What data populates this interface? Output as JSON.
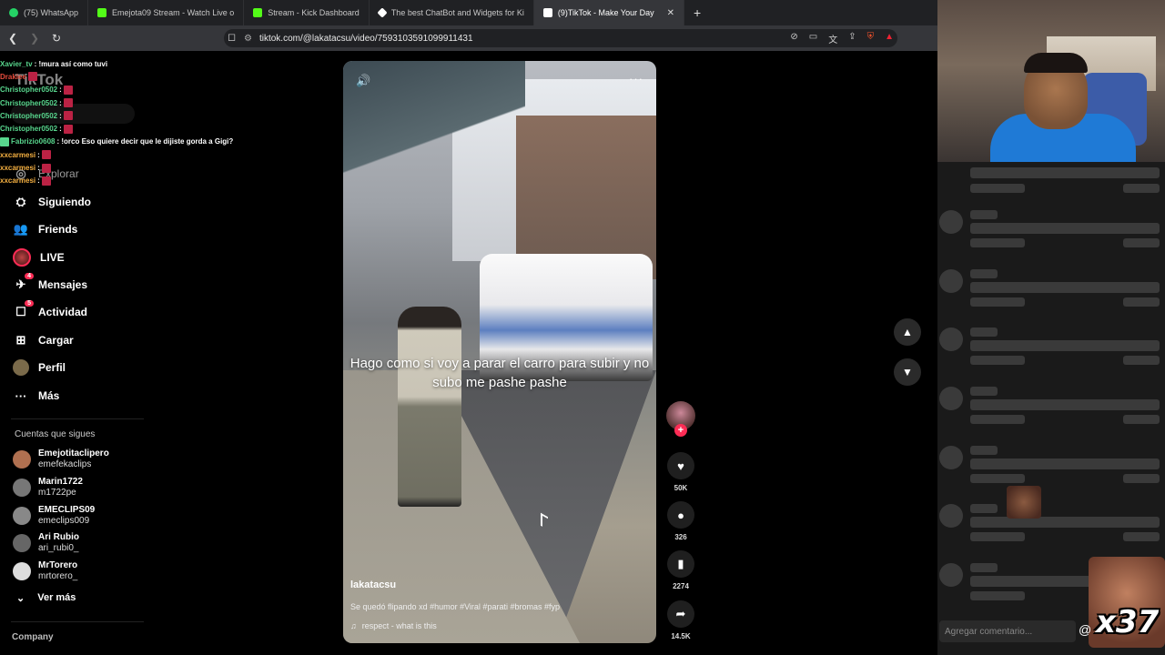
{
  "browser": {
    "tabs": [
      {
        "label": "(75) WhatsApp",
        "favColor": "#25d366"
      },
      {
        "label": "Emejota09 Stream - Watch Live o",
        "favColor": "#53fc18"
      },
      {
        "label": "Stream - Kick Dashboard",
        "favColor": "#53fc18"
      },
      {
        "label": "The best ChatBot and Widgets for Ki",
        "favColor": "#ffffff"
      },
      {
        "label": "(9)TikTok - Make Your Day",
        "favColor": "#ffffff"
      }
    ],
    "new_tab": "+",
    "url": "tiktok.com/@lakatacsu/video/7593103591099911431"
  },
  "tiktok": {
    "logo": "TikTok",
    "nav": [
      {
        "label": "Explorar",
        "icon": "compass-icon"
      },
      {
        "label": "Siguiendo",
        "icon": "following-icon"
      },
      {
        "label": "Friends",
        "icon": "friends-icon"
      },
      {
        "label": "LIVE",
        "icon": "live-icon"
      },
      {
        "label": "Mensajes",
        "icon": "messages-icon",
        "badge": "4"
      },
      {
        "label": "Actividad",
        "icon": "activity-icon",
        "badge": "5"
      },
      {
        "label": "Cargar",
        "icon": "upload-icon"
      },
      {
        "label": "Perfil",
        "icon": "profile-icon"
      },
      {
        "label": "Más",
        "icon": "more-icon"
      }
    ],
    "following_header": "Cuentas que sigues",
    "following": [
      {
        "name": "Emejotitaclipero",
        "handle": "emefekaclips",
        "color": "#b07050"
      },
      {
        "name": "Marin1722",
        "handle": "m1722pe",
        "color": "#777777"
      },
      {
        "name": "EMECLIPS09",
        "handle": "emeclips009",
        "color": "#888888"
      },
      {
        "name": "Ari Rubio",
        "handle": "ari_rubi0_",
        "color": "#666666"
      },
      {
        "name": "MrTorero",
        "handle": "mrtorero_",
        "color": "#dddddd"
      }
    ],
    "see_more": "Ver más",
    "company": "Company",
    "video": {
      "caption": "Hago como si voy a parar el carro para subir y no subo me pashe pashe",
      "username": "lakatacsu",
      "description": "Se quedó flipando xd #humor #Viral #parati #bromas #fyp",
      "music": "respect - what is this"
    },
    "actions": {
      "likes": "50K",
      "comments": "326",
      "saves": "2274",
      "shares": "14.5K"
    }
  },
  "chat_overlay": [
    {
      "user": "Xavier_tv",
      "color": "#58d68d",
      "text": ": !mura así como tuvi"
    },
    {
      "user": "Drakiee",
      "color": "#e74c3c",
      "text": ""
    },
    {
      "user": "Christopher0502",
      "color": "#58d68d",
      "text": ":"
    },
    {
      "user": "Christopher0502",
      "color": "#58d68d",
      "text": ":"
    },
    {
      "user": "Christopher0502",
      "color": "#58d68d",
      "text": ":"
    },
    {
      "user": "Christopher0502",
      "color": "#58d68d",
      "text": ":"
    },
    {
      "user": "Fabrizio0608",
      "color": "#58d68d",
      "text": ": !orco Eso quiere decir que le dijiste gorda a Gigi?"
    },
    {
      "user": "xxcarmesi",
      "color": "#f5b041",
      "text": ":"
    },
    {
      "user": "xxcarmesi",
      "color": "#f5b041",
      "text": ":"
    },
    {
      "user": "xxcarmesi",
      "color": "#f5b041",
      "text": ":"
    }
  ],
  "stream_panel": {
    "comment_placeholder": "Agregar comentario...",
    "at_icon": "@",
    "counter": "x37"
  }
}
